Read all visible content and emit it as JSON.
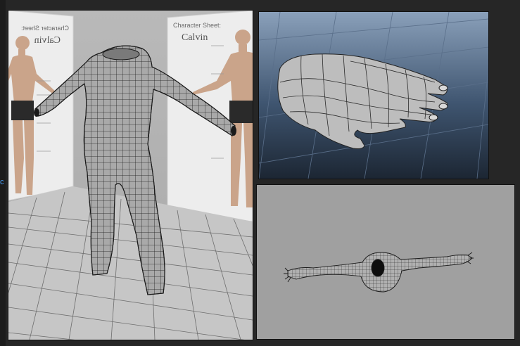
{
  "screen_edge": {
    "cue_glyph": "c"
  },
  "viewports": {
    "main": {
      "name": "perspective-body",
      "reference_left": {
        "title": "Character Sheet:",
        "name": "Calvin",
        "mirrored": true
      },
      "reference_right": {
        "title": "Character Sheet:",
        "name": "Calvin",
        "mirrored": false
      }
    },
    "hand": {
      "name": "perspective-hand"
    },
    "top": {
      "name": "top-view-body"
    }
  },
  "colors": {
    "app_bg": "#262626",
    "grid_floor": "#c8c8c8",
    "grid_line": "#6e6e6e",
    "mesh_fill": "#a8a8a8",
    "mesh_wire": "#1a1a1a",
    "hand_bg_top": "#8aa0ba",
    "hand_bg_bottom": "#1c2633",
    "top_bg": "#a0a0a0"
  }
}
